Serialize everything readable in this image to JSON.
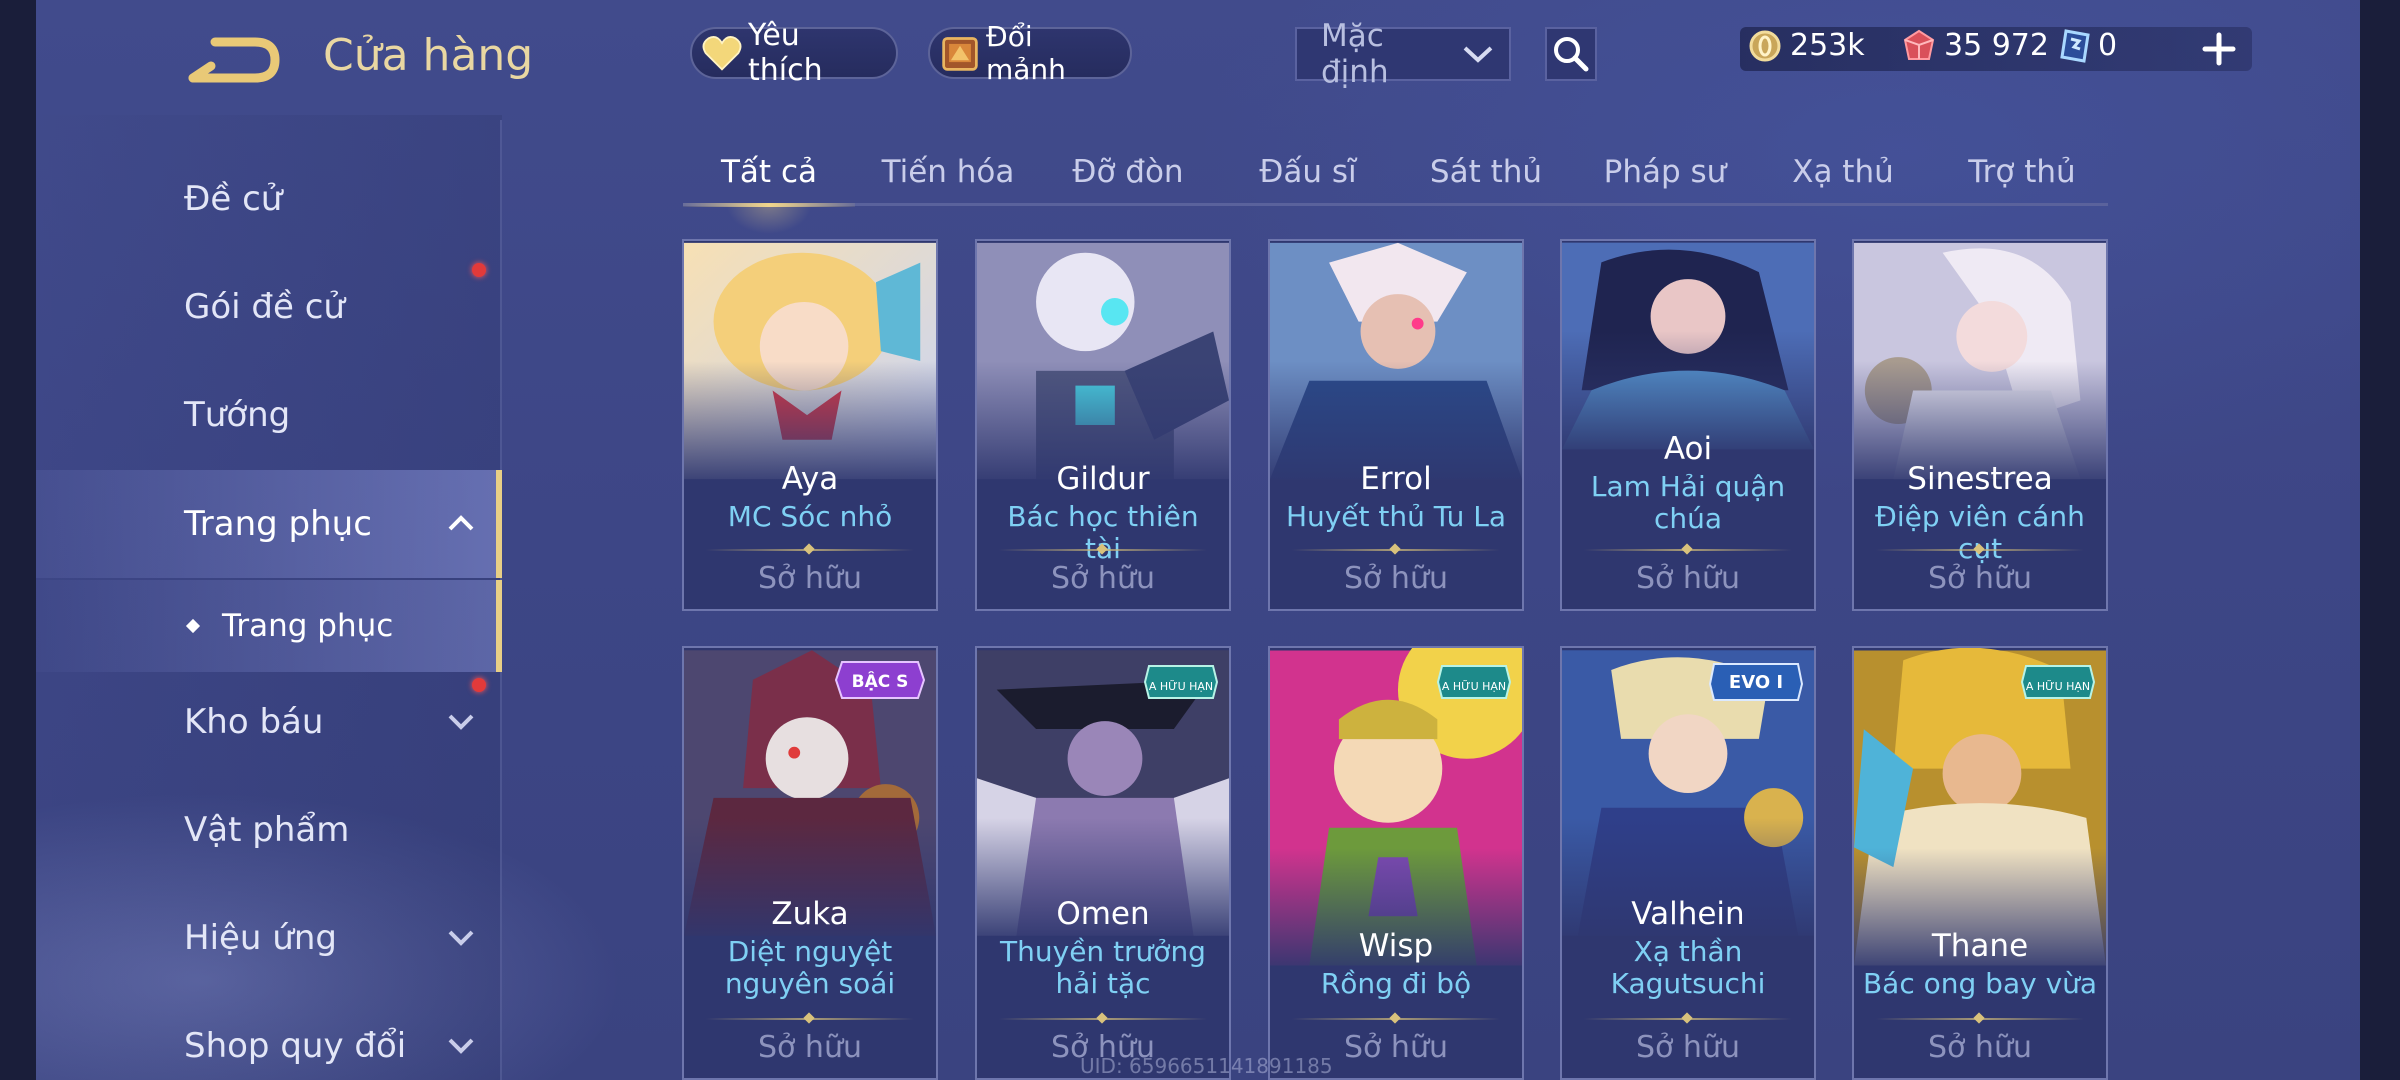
{
  "header": {
    "title": "Cửa hàng",
    "favorites_label": "Yêu thích",
    "exchange_label": "Đổi mảnh",
    "sort_value": "Mặc định"
  },
  "currency": {
    "gold": "253k",
    "ruby": "35 972",
    "voucher": "0"
  },
  "sidebar": {
    "items": [
      {
        "label": "Đề cử"
      },
      {
        "label": "Gói đề cử"
      },
      {
        "label": "Tướng"
      },
      {
        "label": "Trang phục"
      },
      {
        "label": "Kho báu"
      },
      {
        "label": "Vật phẩm"
      },
      {
        "label": "Hiệu ứng"
      },
      {
        "label": "Shop quy đổi"
      }
    ],
    "sub_item": "Trang phục"
  },
  "tabs": [
    "Tất cả",
    "Tiến hóa",
    "Đỡ đòn",
    "Đấu sĩ",
    "Sát thủ",
    "Pháp sư",
    "Xạ thủ",
    "Trợ thủ"
  ],
  "cards": [
    {
      "hero": "Aya",
      "skin": "MC Sóc nhỏ",
      "status": "Sở hữu",
      "badge": ""
    },
    {
      "hero": "Gildur",
      "skin": "Bác học thiên tài",
      "status": "Sở hữu",
      "badge": ""
    },
    {
      "hero": "Errol",
      "skin": "Huyết thủ Tu La",
      "status": "Sở hữu",
      "badge": ""
    },
    {
      "hero": "Aoi",
      "skin": "Lam Hải quận chúa",
      "status": "Sở hữu",
      "badge": ""
    },
    {
      "hero": "Sinestrea",
      "skin": "Điệp viên cánh cụt",
      "status": "Sở hữu",
      "badge": ""
    },
    {
      "hero": "Zuka",
      "skin": "Diệt nguyệt nguyên soái",
      "status": "Sở hữu",
      "badge": "BẬC S"
    },
    {
      "hero": "Omen",
      "skin": "Thuyền trưởng hải tặc",
      "status": "Sở hữu",
      "badge": "A HỮU HẠN"
    },
    {
      "hero": "Wisp",
      "skin": "Rồng đi bộ",
      "status": "Sở hữu",
      "badge": "A HỮU HẠN"
    },
    {
      "hero": "Valhein",
      "skin": "Xạ thần Kagutsuchi",
      "status": "Sở hữu",
      "badge": "EVO I"
    },
    {
      "hero": "Thane",
      "skin": "Bác ong bay vừa",
      "status": "Sở hữu",
      "badge": "A HỮU HẠN"
    }
  ],
  "uid": "UID: 6596651141891185",
  "colors": {
    "accent_gold": "#e8cf86",
    "skin_name": "#7fd0f4",
    "background": "#3d4686",
    "notification": "#e23a3a"
  },
  "icons": [
    "back-arrow-icon",
    "heart-icon",
    "fragment-chest-icon",
    "chevron-down-icon",
    "search-icon",
    "gold-coin-icon",
    "ruby-icon",
    "voucher-icon",
    "plus-icon",
    "chevron-up-icon"
  ]
}
